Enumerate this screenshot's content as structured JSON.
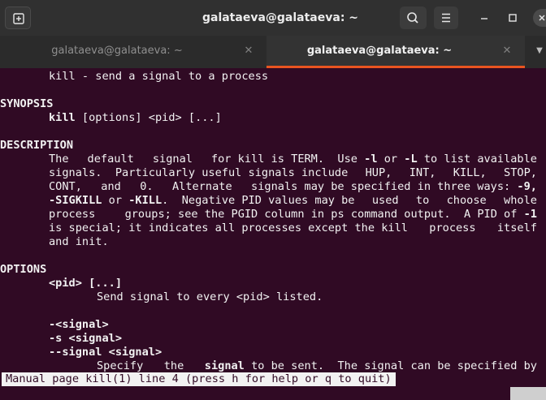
{
  "window": {
    "title": "galataeva@galataeva: ~"
  },
  "titlebar": {
    "new_tab_icon": "new-tab-icon",
    "search_icon": "search-icon",
    "menu_icon": "hamburger-menu-icon",
    "minimize_icon": "minimize-icon",
    "maximize_icon": "maximize-icon",
    "close_icon": "close-icon"
  },
  "tabs": [
    {
      "label": "galataeva@galataeva: ~",
      "active": false,
      "close": "✕"
    },
    {
      "label": "galataeva@galataeva: ~",
      "active": true,
      "close": "✕"
    }
  ],
  "tab_dropdown": "▼",
  "colors": {
    "terminal_bg": "#300a24",
    "accent": "#e95420",
    "text": "#f2f2f2"
  },
  "man": {
    "name_line": "kill - send a signal to a process",
    "synopsis_heading": "SYNOPSIS",
    "synopsis": {
      "cmd": "kill",
      "args": " [options] <pid> [...]"
    },
    "description_heading": "DESCRIPTION",
    "d1": {
      "a": "The",
      "b": "default",
      "c": "signal",
      "d": "for kill is TERM.  Use",
      "e": "-l",
      "f": "or",
      "g": "-L",
      "h": "to list available"
    },
    "d2": {
      "a": "signals.  Particularly useful signals include",
      "b": "HUP,",
      "c": "INT,",
      "d": "KILL,",
      "e": "STOP,"
    },
    "d3": {
      "a": "CONT,",
      "b": "and",
      "c": "0.",
      "d": "Alternate",
      "e": "signals may be specified in three ways:",
      "f": "-9,"
    },
    "d4": {
      "a": "-SIGKILL",
      "b": "or",
      "c": "-KILL",
      "d": ".  Negative PID values may be",
      "e": "used",
      "f": "to",
      "g": "choose",
      "h": "whole"
    },
    "d5": {
      "a": "process",
      "b": "groups; see the PGID column in ps command output.  A PID of",
      "c": "-1"
    },
    "d6": {
      "a": "is special; it indicates all processes except the kill",
      "b": "process",
      "c": "itself"
    },
    "d7": "and init.",
    "options_heading": "OPTIONS",
    "opt_pid": "<pid> [...]",
    "opt_pid_desc": "Send signal to every <pid> listed.",
    "opt_signal_1": "-<signal>",
    "opt_signal_2": "-s <signal>",
    "opt_signal_3": "--signal <signal>",
    "opt_signal_desc": {
      "a": "Specify",
      "b": "the",
      "c": "signal",
      "d": "to be sent.  The signal can be specified by"
    },
    "status_line": "Manual page kill(1) line 4 (press h for help or q to quit)"
  }
}
